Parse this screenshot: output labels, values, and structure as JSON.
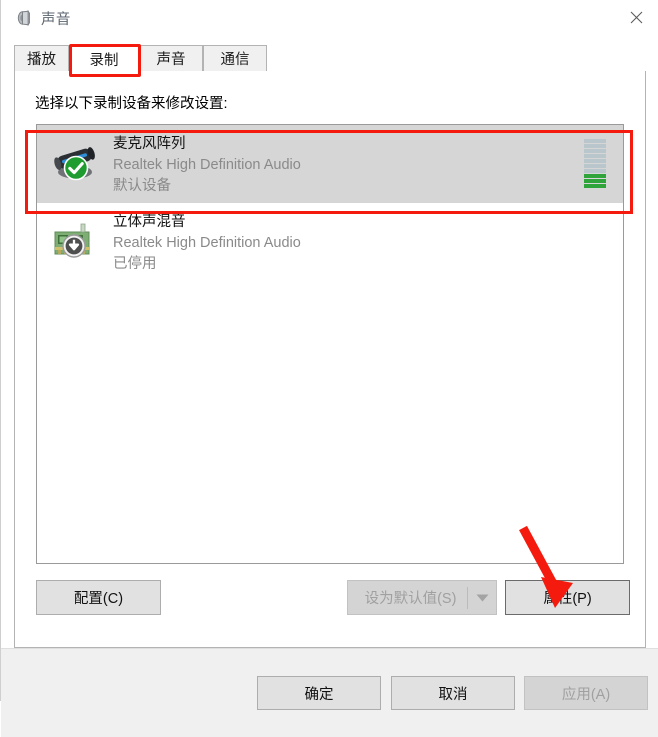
{
  "window": {
    "title": "声音",
    "icon": "speaker-icon",
    "close_label": "✕"
  },
  "tabs": [
    {
      "label": "播放",
      "selected": false
    },
    {
      "label": "录制",
      "selected": true
    },
    {
      "label": "声音",
      "selected": false
    },
    {
      "label": "通信",
      "selected": false
    }
  ],
  "panel": {
    "instruction": "选择以下录制设备来修改设置:"
  },
  "devices": [
    {
      "name": "麦克风阵列",
      "driver": "Realtek High Definition Audio",
      "status": "默认设备",
      "icon": "microphone-array-icon",
      "badge": "green-check-icon",
      "selected": true,
      "meter": {
        "segments": 10,
        "active": 3
      }
    },
    {
      "name": "立体声混音",
      "driver": "Realtek High Definition Audio",
      "status": "已停用",
      "icon": "sound-card-icon",
      "badge": "disabled-down-arrow-icon",
      "selected": false,
      "meter": null
    }
  ],
  "buttons": {
    "configure": "配置(C)",
    "set_default": "设为默认值(S)",
    "set_default_arrow": "chevron-down-icon",
    "properties": "属性(P)",
    "ok": "确定",
    "cancel": "取消",
    "apply": "应用(A)"
  },
  "annotations": {
    "color": "#f41b0e",
    "tab_highlight": "录制",
    "device_highlight": "麦克风阵列",
    "arrow_target": "属性(P)"
  }
}
